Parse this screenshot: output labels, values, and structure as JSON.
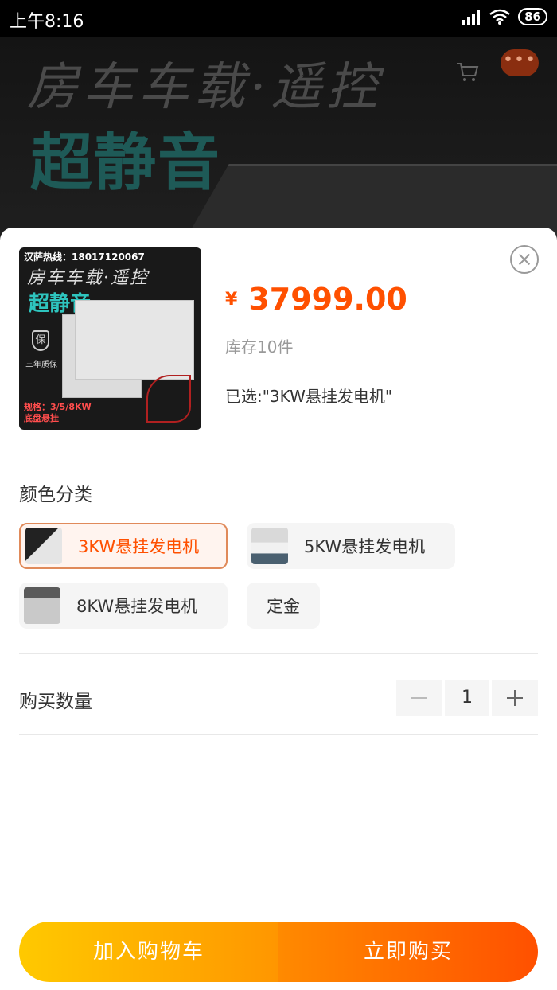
{
  "status_bar": {
    "time": "上午8:16",
    "battery": "86"
  },
  "banner": {
    "line1": "房车车载·遥控",
    "line2": "超静音"
  },
  "product": {
    "image": {
      "hotline": "汉萨热线：18017120067",
      "line1": "房车车载·遥控",
      "line2": "超静音",
      "shield": "保",
      "warranty": "三年质保",
      "spec_line1": "规格：3/5/8KW",
      "spec_line2": "底盘悬挂"
    },
    "currency": "¥",
    "price": "37999.00",
    "stock": "库存10件",
    "selected": "已选:\"3KW悬挂发电机\""
  },
  "options": {
    "title": "颜色分类",
    "items": [
      {
        "label": "3KW悬挂发电机",
        "selected": true
      },
      {
        "label": "5KW悬挂发电机",
        "selected": false
      },
      {
        "label": "8KW悬挂发电机",
        "selected": false
      },
      {
        "label": "定金",
        "selected": false
      }
    ]
  },
  "quantity": {
    "label": "购买数量",
    "value": "1"
  },
  "actions": {
    "add_to_cart": "加入购物车",
    "buy_now": "立即购买"
  },
  "colors": {
    "accent": "#ff5000",
    "cart_gradient": [
      "#ffc900",
      "#ff9600"
    ],
    "buy_gradient": [
      "#ff8a00",
      "#ff5000"
    ]
  }
}
